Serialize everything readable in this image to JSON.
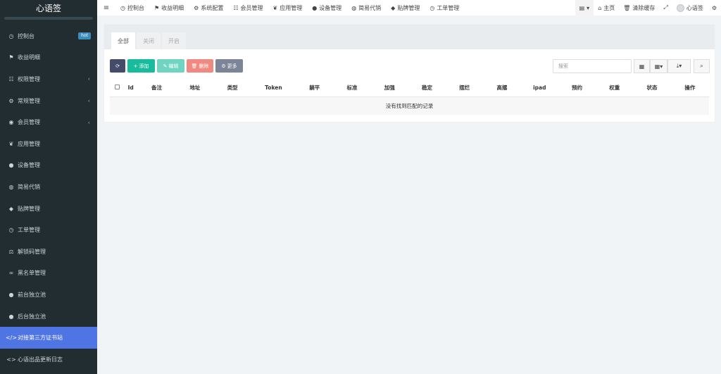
{
  "app": {
    "title": "心语签"
  },
  "sidebar": {
    "items": [
      {
        "label": "控制台",
        "icon": "dashboard-icon",
        "glyph": "◷",
        "badge": "hot",
        "arrow": false
      },
      {
        "label": "收益明细",
        "icon": "flag-icon",
        "glyph": "⚑",
        "arrow": false
      },
      {
        "label": "权限管理",
        "icon": "users-icon",
        "glyph": "☷",
        "arrow": true
      },
      {
        "label": "常规管理",
        "icon": "gears-icon",
        "glyph": "⚙",
        "arrow": true
      },
      {
        "label": "会员管理",
        "icon": "user-circle-icon",
        "glyph": "◉",
        "arrow": true
      },
      {
        "label": "应用管理",
        "icon": "leaf-icon",
        "glyph": "❦",
        "arrow": false
      },
      {
        "label": "设备管理",
        "icon": "circle-icon",
        "glyph": "●",
        "arrow": false
      },
      {
        "label": "简易代销",
        "icon": "circle-dots-icon",
        "glyph": "◍",
        "arrow": false
      },
      {
        "label": "贴牌管理",
        "icon": "tags-icon",
        "glyph": "◆",
        "arrow": false
      },
      {
        "label": "工单管理",
        "icon": "dashboard-icon",
        "glyph": "◷",
        "arrow": false
      },
      {
        "label": "解锁码管理",
        "icon": "balance-scale-icon",
        "glyph": "⚖",
        "arrow": false
      },
      {
        "label": "黑名单管理",
        "icon": "bicycle-icon",
        "glyph": "∞",
        "arrow": false
      },
      {
        "label": "前台独立池",
        "icon": "question-icon",
        "glyph": "●",
        "arrow": false
      },
      {
        "label": "后台独立池",
        "icon": "apple-icon",
        "glyph": "●",
        "arrow": false
      },
      {
        "label": "对接第三方证书站",
        "icon": "code-icon",
        "glyph": "</>",
        "arrow": false,
        "active": true
      },
      {
        "label": "心语出品更新日志",
        "icon": "code-icon",
        "glyph": "<>",
        "arrow": false
      }
    ]
  },
  "topnav": {
    "items": [
      {
        "label": "控制台",
        "icon": "dashboard-icon",
        "glyph": "◷"
      },
      {
        "label": "收益明细",
        "icon": "flag-icon",
        "glyph": "⚑"
      },
      {
        "label": "系统配置",
        "icon": "gear-icon",
        "glyph": "⚙"
      },
      {
        "label": "会员管理",
        "icon": "users-icon",
        "glyph": "☷"
      },
      {
        "label": "应用管理",
        "icon": "leaf-icon",
        "glyph": "❦"
      },
      {
        "label": "设备管理",
        "icon": "circle-icon",
        "glyph": "●"
      },
      {
        "label": "简易代销",
        "icon": "circle-dots-icon",
        "glyph": "◍"
      },
      {
        "label": "贴牌管理",
        "icon": "tags-icon",
        "glyph": "◆"
      },
      {
        "label": "工单管理",
        "icon": "dashboard-icon",
        "glyph": "◷"
      }
    ],
    "right": {
      "home": "主页",
      "clear_cache": "清除缓存",
      "user": "心语签"
    }
  },
  "tabs": [
    {
      "label": "全部",
      "active": true
    },
    {
      "label": "关闭",
      "active": false
    },
    {
      "label": "开启",
      "active": false
    }
  ],
  "toolbar": {
    "add": "添加",
    "edit": "编辑",
    "delete": "删除",
    "more": "更多",
    "search_placeholder": "搜索"
  },
  "table": {
    "columns": [
      "Id",
      "备注",
      "地址",
      "类型",
      "Token",
      "躺平",
      "标准",
      "加强",
      "稳定",
      "摆烂",
      "高撂",
      "ipad",
      "预约",
      "权重",
      "状态",
      "操作"
    ],
    "empty_text": "没有找到匹配的记录"
  },
  "colors": {
    "sidebar_bg": "#222d32",
    "active_item": "#4f74e3",
    "add_btn": "#18bc9c",
    "refresh_btn": "#444c69",
    "delete_btn": "#f08a80"
  }
}
